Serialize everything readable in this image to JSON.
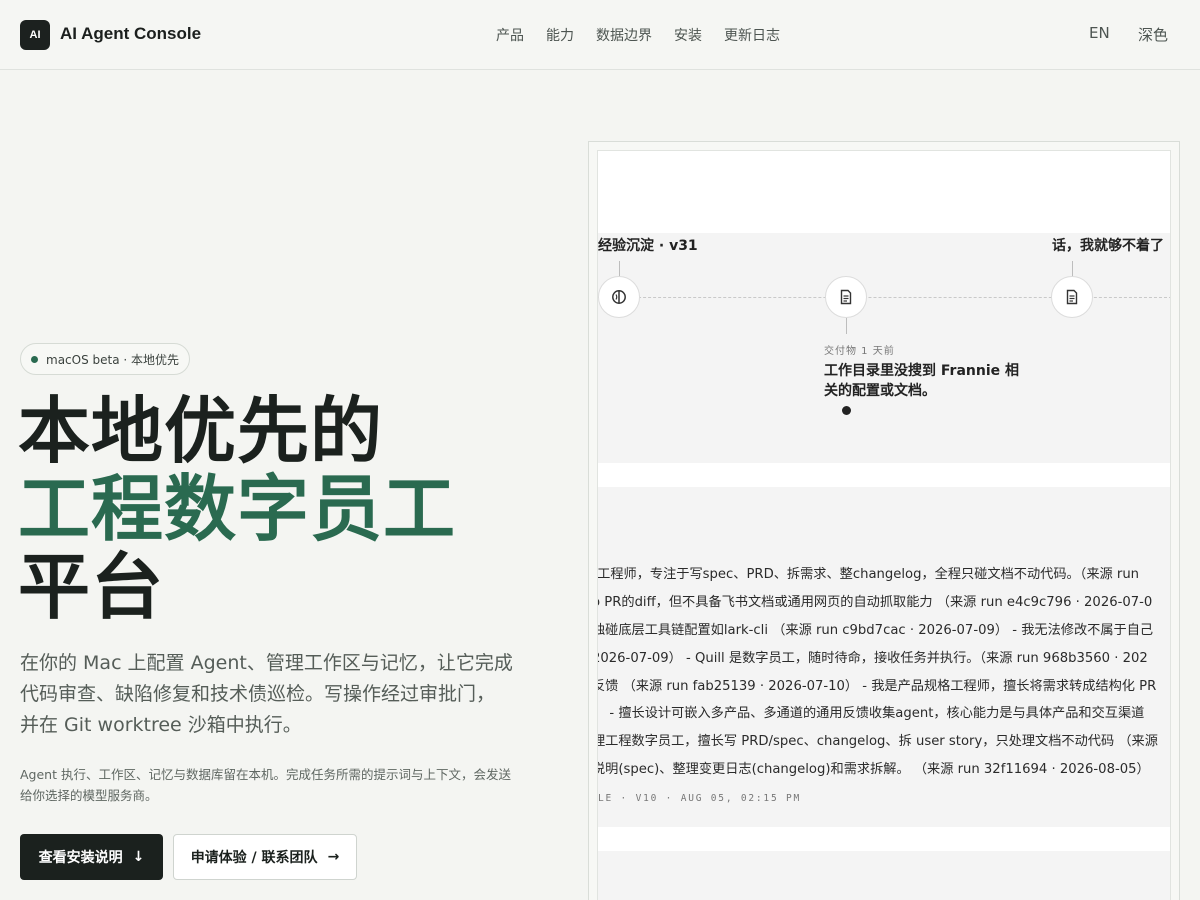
{
  "header": {
    "logo_text": "AI",
    "brand": "AI Agent Console",
    "nav": [
      "产品",
      "能力",
      "数据边界",
      "安装",
      "更新日志"
    ],
    "lang": "EN",
    "theme": "深色"
  },
  "hero": {
    "badge": "macOS beta · 本地优先",
    "headline_line1": "本地优先的",
    "headline_line2": "工程数字员工",
    "headline_line3": "平台",
    "lead_line1": "在你的 Mac 上配置 Agent、管理工作区与记忆，让它完成",
    "lead_line2": "代码审查、缺陷修复和技术债巡检。写操作经过审批门，",
    "lead_line3": "并在 Git worktree 沙箱中执行。",
    "note_line1": "Agent 执行、工作区、记忆与数据库留在本机。完成任务所需的提示词与上下文，会发送",
    "note_line2": "给你选择的模型服务商。",
    "primary_button": "查看安装说明",
    "primary_arrow": "↓",
    "secondary_button": "申请体验 / 联系团队",
    "secondary_arrow": "→"
  },
  "preview": {
    "timeline": {
      "label_left": "经验沉淀 · v31",
      "label_right": "话，我就够不着了",
      "node_icons": [
        "brain-icon",
        "document-icon",
        "document-icon"
      ],
      "meta": "交付物  1  天前",
      "text_line1": "工作目录里没搜到 Frannie 相",
      "text_line2": "关的配置或文档。"
    },
    "memory": {
      "lines": [
        "t工程师，专注于写spec、PRD、拆需求、整changelog，全程只碰文档不动代码。（来源 run",
        "o PR的diff，但不具备飞书文档或通用网页的自动抓取能力 （来源 run e4c9c796 · 2026-07-0",
        "独碰底层工具链配置如lark-cli （来源 run c9bd7cac · 2026-07-09） - 我无法修改不属于自己",
        "2026-07-09） - Quill 是数字员工，随时待命，接收任务并执行。（来源 run 968b3560 · 202",
        "反馈 （来源 run fab25139 · 2026-07-10） - 我是产品规格工程师，擅长将需求转成结构化 PR",
        "） - 擅长设计可嵌入多产品、多通道的通用反馈收集agent，核心能力是与具体产品和交互渠道",
        "理工程数字员工，擅长写 PRD/spec、changelog、拆 user story，只处理文档不动代码 （来源",
        "说明(spec)、整理变更日志(changelog)和需求拆解。 （来源 run 32f11694 · 2026-08-05）"
      ],
      "footer": "LE · V10 · AUG 05, 02:15 PM"
    }
  }
}
